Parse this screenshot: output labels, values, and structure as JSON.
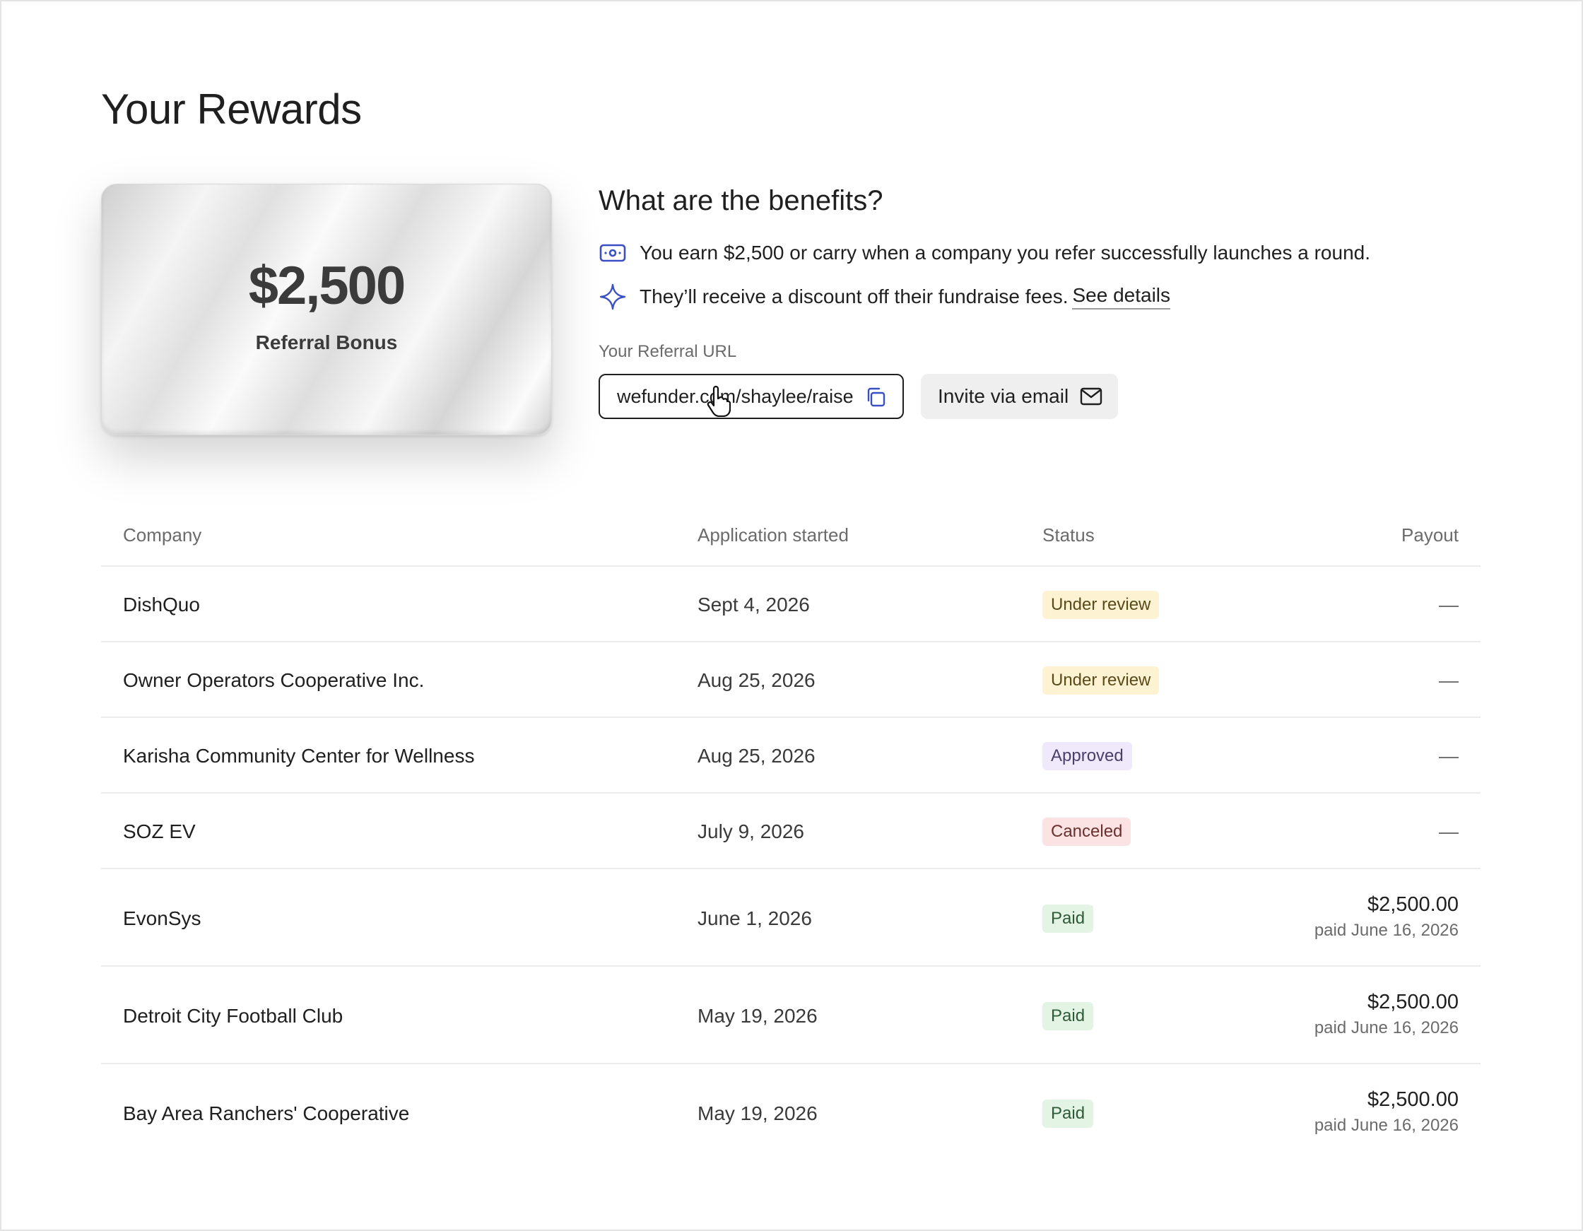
{
  "page": {
    "title": "Your Rewards"
  },
  "card": {
    "amount": "$2,500",
    "label": "Referral Bonus"
  },
  "benefits": {
    "title": "What are the benefits?",
    "items": [
      {
        "icon": "cash-icon",
        "text": "You earn $2,500 or carry when a company you refer successfully launches a round."
      },
      {
        "icon": "sparkle-icon",
        "text": "They’ll receive a discount off their fundraise fees.",
        "link": "See details"
      }
    ]
  },
  "referral": {
    "label": "Your Referral URL",
    "url": "wefunder.com/shaylee/raise",
    "invite_label": "Invite via email"
  },
  "table": {
    "headers": {
      "company": "Company",
      "date": "Application started",
      "status": "Status",
      "payout": "Payout"
    },
    "rows": [
      {
        "company": "DishQuo",
        "date": "Sept 4, 2026",
        "status": "Under review",
        "payout": "—"
      },
      {
        "company": "Owner Operators Cooperative Inc.",
        "date": "Aug 25, 2026",
        "status": "Under review",
        "payout": "—"
      },
      {
        "company": "Karisha Community Center for Wellness",
        "date": "Aug 25, 2026",
        "status": "Approved",
        "payout": "—"
      },
      {
        "company": "SOZ EV",
        "date": "July 9, 2026",
        "status": "Canceled",
        "payout": "—"
      },
      {
        "company": "EvonSys",
        "date": "June 1, 2026",
        "status": "Paid",
        "payout": "$2,500.00",
        "payout_note": "paid June 16, 2026"
      },
      {
        "company": "Detroit City Football Club",
        "date": "May 19, 2026",
        "status": "Paid",
        "payout": "$2,500.00",
        "payout_note": "paid June 16, 2026"
      },
      {
        "company": "Bay Area Ranchers' Cooperative",
        "date": "May 19, 2026",
        "status": "Paid",
        "payout": "$2,500.00",
        "payout_note": "paid June 16, 2026"
      }
    ]
  },
  "colors": {
    "accent": "#3b4fc4",
    "status_review_bg": "#fdf3d3",
    "status_approved_bg": "#efe9fb",
    "status_canceled_bg": "#fbe3e3",
    "status_paid_bg": "#e3f4e5"
  }
}
